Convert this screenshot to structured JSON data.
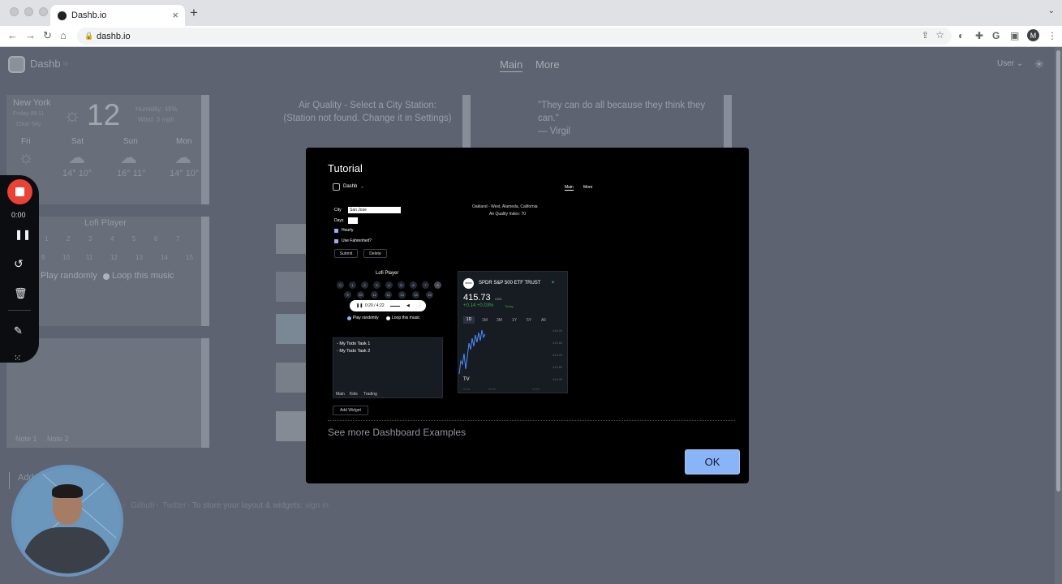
{
  "browser": {
    "tab_title": "Dashb.io",
    "url": "dashb.io",
    "new_tab_symbol": "+",
    "close_tab_symbol": "×",
    "tab_menu_symbol": "⌄",
    "profile_initial": "M",
    "icons": [
      "back-icon",
      "forward-icon",
      "reload-icon",
      "home-icon",
      "lock-icon",
      "share-icon",
      "star-icon",
      "extension-icon",
      "puzzle-icon",
      "google-icon",
      "sidebar-icon",
      "more-icon"
    ]
  },
  "app": {
    "brand": "Dashb",
    "brand_suffix": "io",
    "tabs": [
      "Main",
      "More"
    ],
    "user_label": "User",
    "weather": {
      "city": "New York",
      "date": "Friday 09:11",
      "condition": "Clear Sky",
      "temp": "12",
      "humidity": "Humidity: 49%",
      "wind": "Wind: 3 mph",
      "days": [
        {
          "day": "Fri",
          "temp": "14° 10°"
        },
        {
          "day": "Sat",
          "temp": "14° 10°"
        },
        {
          "day": "Sun",
          "temp": "16° 11°"
        },
        {
          "day": "Mon",
          "temp": "14° 10°"
        }
      ]
    },
    "air_quality": {
      "line1": "Air Quality - Select a City Station:",
      "line2": "(Station not found. Change it in Settings)"
    },
    "quote": {
      "text": "\"They can do all because they think they can.\"",
      "author": "— Virgil"
    },
    "lofi": {
      "title": "Lofi Player",
      "row1": [
        "1",
        "2",
        "3",
        "4",
        "5",
        "6",
        "7"
      ],
      "row2": [
        "9",
        "10",
        "11",
        "12",
        "13",
        "14",
        "15"
      ],
      "play_randomly": "Play randomly",
      "loop": "Loop this music"
    },
    "notes": {
      "tabs": [
        "Note 1",
        "Note 2"
      ]
    },
    "add_widget": "Add",
    "footer": {
      "text": "- To store your layout & widgets:",
      "links": [
        "Github",
        "Twitter"
      ],
      "signin": "sign in"
    }
  },
  "modal": {
    "title": "Tutorial",
    "see_more": "See more Dashboard Examples",
    "ok_label": "OK",
    "preview": {
      "brand": "Dashb",
      "brand_suffix": "io",
      "nav": [
        "Main",
        "More"
      ],
      "city_label": "City",
      "city_value": "San Jose",
      "days_label": "Days",
      "hourly": "Hourly",
      "fahrenheit": "Use Fahrenheit?",
      "submit": "Submit",
      "delete": "Delete",
      "aq_line1": "Oakland - West, Alameda, California",
      "aq_line2": "Air Quality Index: 70",
      "lofi_title": "Lofi Player",
      "lofi_row1": [
        "0",
        "1",
        "2",
        "3",
        "4",
        "5",
        "6",
        "7",
        "8"
      ],
      "lofi_row2": [
        "9",
        "10",
        "11",
        "12",
        "13",
        "14",
        "15"
      ],
      "player_time": "0:20 / 4:22",
      "play_randomly": "Play randomly",
      "loop": "Loop this music",
      "todos": [
        "- My Todo Task 1",
        "- My Todo Task 2"
      ],
      "board_tabs": [
        "Main",
        "Kids",
        "Trading"
      ],
      "add_widget": "Add Widget",
      "stock": {
        "badge": "SPDR",
        "name": "SPDR S&P 500 ETF TRUST",
        "price": "415.73",
        "currency": "USD",
        "change": "+0.14 +0.03%",
        "today": "Today",
        "ranges": [
          "1D",
          "1M",
          "3M",
          "1Y",
          "5Y",
          "All"
        ],
        "selected_range": "1D",
        "y_ticks": [
          "416.00",
          "415.60",
          "415.20",
          "414.80",
          "414.40"
        ],
        "x_ticks": [
          "09:41",
          "09:09",
          "12:00"
        ],
        "trend": "blue-line"
      }
    }
  },
  "recorder": {
    "time": "0:00"
  }
}
